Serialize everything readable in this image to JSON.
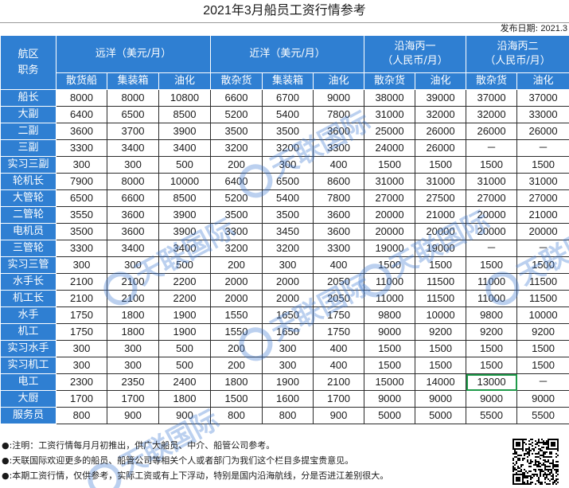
{
  "title": "2021年3月船员工资行情参考",
  "issue": {
    "label": "发布日期:",
    "date": "2021.3"
  },
  "header": {
    "rank_title_line1": "航区",
    "rank_title_line2": "职务",
    "groups": [
      {
        "label": "远洋（美元/月）",
        "span": 3
      },
      {
        "label": "近洋（美元/月）",
        "span": 3
      },
      {
        "label": "沿海丙一\n（人民币/月）",
        "span": 2
      },
      {
        "label": "沿海丙二\n（人民币/月）",
        "span": 2
      }
    ],
    "subheaders": [
      "散货船",
      "集装箱",
      "油化",
      "散杂货",
      "集装箱",
      "油化",
      "散杂货",
      "油化",
      "散杂货",
      "油化"
    ]
  },
  "rows": [
    {
      "rank": "船长",
      "values": [
        "8000",
        "8000",
        "10800",
        "6600",
        "6700",
        "9000",
        "38000",
        "39000",
        "37000",
        "37000"
      ]
    },
    {
      "rank": "大副",
      "values": [
        "6400",
        "6500",
        "8500",
        "5200",
        "5400",
        "7800",
        "31000",
        "32000",
        "32000",
        "33000"
      ]
    },
    {
      "rank": "二副",
      "values": [
        "3600",
        "3700",
        "3900",
        "3500",
        "3500",
        "3600",
        "25000",
        "26000",
        "26000",
        "26000"
      ]
    },
    {
      "rank": "三副",
      "values": [
        "3300",
        "3400",
        "3400",
        "3200",
        "3200",
        "3300",
        "24000",
        "26000",
        "－",
        "－"
      ]
    },
    {
      "rank": "实习三副",
      "values": [
        "300",
        "300",
        "500",
        "200",
        "300",
        "400",
        "1500",
        "1500",
        "1500",
        "1500"
      ]
    },
    {
      "rank": "轮机长",
      "values": [
        "7900",
        "8000",
        "10000",
        "6400",
        "6500",
        "8600",
        "31000",
        "31000",
        "31000",
        "31000"
      ]
    },
    {
      "rank": "大管轮",
      "values": [
        "6500",
        "6600",
        "8500",
        "5200",
        "5400",
        "7800",
        "27000",
        "27500",
        "27000",
        "27000"
      ]
    },
    {
      "rank": "二管轮",
      "values": [
        "3550",
        "3600",
        "3900",
        "3500",
        "3500",
        "3600",
        "20000",
        "21000",
        "20000",
        "21000"
      ]
    },
    {
      "rank": "电机员",
      "values": [
        "3500",
        "3600",
        "3900",
        "3300",
        "3450",
        "3600",
        "20000",
        "20000",
        "20000",
        "20000"
      ]
    },
    {
      "rank": "三管轮",
      "values": [
        "3300",
        "3400",
        "3400",
        "3200",
        "3200",
        "3300",
        "19000",
        "19000",
        "－",
        "－"
      ]
    },
    {
      "rank": "实习三管",
      "values": [
        "300",
        "300",
        "500",
        "200",
        "300",
        "400",
        "1500",
        "1500",
        "1500",
        "1500"
      ]
    },
    {
      "rank": "水手长",
      "values": [
        "2100",
        "2100",
        "2200",
        "2000",
        "2000",
        "2050",
        "11000",
        "11500",
        "11000",
        "11500"
      ]
    },
    {
      "rank": "机工长",
      "values": [
        "2100",
        "2100",
        "2200",
        "2000",
        "2000",
        "2050",
        "11000",
        "11500",
        "11000",
        "11500"
      ]
    },
    {
      "rank": "水手",
      "values": [
        "1750",
        "1800",
        "1900",
        "1550",
        "1650",
        "1750",
        "9800",
        "10000",
        "9800",
        "10000"
      ]
    },
    {
      "rank": "机工",
      "values": [
        "1750",
        "1800",
        "1900",
        "1550",
        "1650",
        "1750",
        "9000",
        "9200",
        "9200",
        "9200"
      ]
    },
    {
      "rank": "实习水手",
      "values": [
        "300",
        "300",
        "500",
        "200",
        "300",
        "400",
        "1500",
        "1500",
        "1500",
        "1500"
      ]
    },
    {
      "rank": "实习机工",
      "values": [
        "300",
        "300",
        "500",
        "200",
        "300",
        "400",
        "1500",
        "1500",
        "1500",
        "1500"
      ]
    },
    {
      "rank": "电工",
      "values": [
        "2300",
        "2350",
        "2400",
        "1800",
        "1900",
        "2100",
        "15000",
        "14000",
        "13000",
        "－"
      ]
    },
    {
      "rank": "大厨",
      "values": [
        "1700",
        "1700",
        "1800",
        "1500",
        "1600",
        "1700",
        "9000",
        "9000",
        "9000",
        "9000"
      ]
    },
    {
      "rank": "服务员",
      "values": [
        "800",
        "900",
        "900",
        "800",
        "800",
        "900",
        "5000",
        "5000",
        "5500",
        "5500"
      ]
    }
  ],
  "selected_cell": {
    "row": 17,
    "col": 8
  },
  "notes": [
    "●:注明：工资行情每月月初推出，供广大船员、中介、船管公司参考。",
    "●:天联国际欢迎更多的船员、船管公司等相关个人或者部门为我们这个栏目多提宝贵意见。",
    "●:本期工资行情，仅供参考，实际工资或有上下浮动，特别是国内沿海航线，分是否进江差别很大。"
  ],
  "watermark": {
    "text": "天联国际"
  },
  "colors": {
    "header_blue": "#2f7fd2",
    "selection_green": "#1f9a4a",
    "watermark": "#3c78d2"
  }
}
